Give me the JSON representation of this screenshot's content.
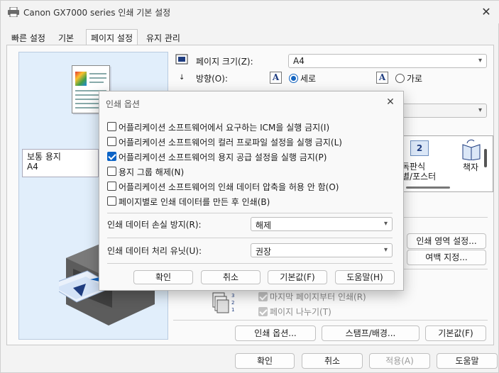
{
  "window": {
    "title": "Canon GX7000 series 인쇄 기본 설정",
    "close_glyph": "✕"
  },
  "tabs": [
    {
      "label": "빠른 설정"
    },
    {
      "label": "기본"
    },
    {
      "label": "페이지 설정"
    },
    {
      "label": "유지 관리"
    }
  ],
  "preview": {
    "media_line1": "보통 용지",
    "media_line2": "A4"
  },
  "page_setup": {
    "page_size_label": "페이지 크기(Z):",
    "page_size_value": "A4",
    "orientation_label": "방향(O):",
    "portrait_label": "세로",
    "landscape_label": "가로",
    "layout_items": [
      {
        "label": "독판식"
      },
      {
        "label": "별/포스터"
      },
      {
        "label": "책자"
      }
    ],
    "print_area_button": "인쇄 영역 설정...",
    "margin_button": "여백 지정...",
    "last_page_first_label": "마지막 페이지부터 인쇄(R)",
    "collate_label": "페이지 나누기(T)",
    "print_options_button": "인쇄 옵션...",
    "stamp_button": "스탬프/배경...",
    "defaults_button": "기본값(F)"
  },
  "footer": {
    "ok": "확인",
    "cancel": "취소",
    "apply": "적용(A)",
    "help": "도움말"
  },
  "modal": {
    "title": "인쇄 옵션",
    "close_glyph": "✕",
    "options": [
      {
        "label": "어플리케이션 소프트웨어에서 요구하는 ICM을 실행 금지(I)",
        "checked": false
      },
      {
        "label": "어플리케이션 소프트웨어의 컬러 프로파일 설정을 실행 금지(L)",
        "checked": false
      },
      {
        "label": "어플리케이션 소프트웨어의 용지 공급 설정을 실행 금지(P)",
        "checked": true
      },
      {
        "label": "용지 그룹 해제(N)",
        "checked": false
      },
      {
        "label": "어플리케이션 소프트웨어의 인쇄 데이터 압축을 허용 안 함(O)",
        "checked": false
      },
      {
        "label": "페이지별로 인쇄 데이터를 만든 후 인쇄(B)",
        "checked": false
      }
    ],
    "loss_label": "인쇄 데이터 손실 방지(R):",
    "loss_value": "해제",
    "unit_label": "인쇄 데이터 처리 유닛(U):",
    "unit_value": "권장",
    "ok": "확인",
    "cancel": "취소",
    "defaults": "기본값(F)",
    "help": "도움말(H)"
  },
  "colors": {
    "accent": "#0b63c6",
    "preview_bg": "#e1eefb"
  }
}
